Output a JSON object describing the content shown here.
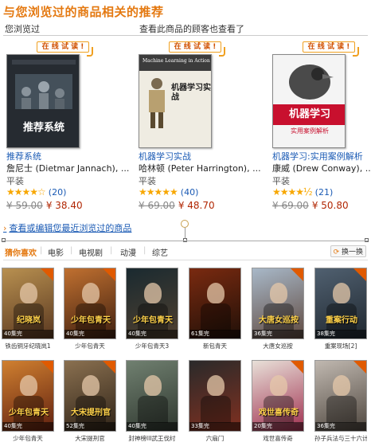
{
  "header": {
    "title": "与您浏览过的商品相关的推荐",
    "viewed_label": "您浏览过",
    "also_viewed_label": "查看此商品的顾客也查看了"
  },
  "badge_text": "在 线 试 读 !",
  "books": [
    {
      "title": "推荐系统",
      "author": "詹尼士 (Dietmar Jannach), ...",
      "format": "平装",
      "rating": 4,
      "stars_text": "★★★★☆",
      "review_count": "(20)",
      "list_price": "¥ 59.00",
      "price": "¥ 38.40",
      "cover_title": "推荐系统",
      "cover_color": "#2a2f36"
    },
    {
      "title": "机器学习实战",
      "author": "哈林顿 (Peter Harrington), ...",
      "format": "平装",
      "rating": 5,
      "stars_text": "★★★★★",
      "review_count": "(40)",
      "list_price": "¥ 69.00",
      "price": "¥ 48.70",
      "cover_title": "机器学习实战",
      "cover_subtitle": "Machine Learning in Action",
      "cover_color": "#efece2"
    },
    {
      "title": "机器学习:实用案例解析",
      "author": "康威 (Drew Conway), ...",
      "format": "平装",
      "rating": 4.5,
      "stars_text": "★★★★½",
      "review_count": "(21)",
      "list_price": "¥ 69.00",
      "price": "¥ 50.80",
      "cover_title": "机器学习",
      "cover_subtitle": "实用案例解析",
      "cover_color": "#f4f4f4",
      "cover_band": "#c8102e"
    }
  ],
  "edit_link": "查看或编辑您最近浏览过的商品",
  "tabs": [
    "猜你喜欢",
    "电影",
    "电视剧",
    "动漫",
    "综艺"
  ],
  "switch_label": "换一换",
  "movies": [
    {
      "title": "铁齿铜牙纪晓岚1",
      "episodes": "40集完",
      "poster_text": "纪晓岚",
      "c1": "#b89050",
      "c2": "#5a3820"
    },
    {
      "title": "少年包青天",
      "episodes": "40集完",
      "poster_text": "少年包青天",
      "c1": "#c07030",
      "c2": "#402010"
    },
    {
      "title": "少年包青天3",
      "episodes": "40集完",
      "poster_text": "少年包青天",
      "c1": "#1a2a30",
      "c2": "#504030"
    },
    {
      "title": "新包青天",
      "episodes": "61集完",
      "poster_text": "",
      "c1": "#7a2a10",
      "c2": "#201008"
    },
    {
      "title": "大唐女巡按",
      "episodes": "36集完",
      "poster_text": "大唐女巡按",
      "c1": "#a8b8c8",
      "c2": "#604a40"
    },
    {
      "title": "重案现场[2]",
      "episodes": "38集完",
      "poster_text": "重案行动",
      "c1": "#506070",
      "c2": "#202830"
    },
    {
      "title": "少年包青天",
      "episodes": "40集完",
      "poster_text": "少年包青天",
      "c1": "#d08030",
      "c2": "#602010"
    },
    {
      "title": "大宋提刑官",
      "episodes": "52集完",
      "poster_text": "大宋提刑官",
      "c1": "#8a7050",
      "c2": "#302418"
    },
    {
      "title": "封神榜III武王伐纣",
      "episodes": "40集完",
      "poster_text": "",
      "c1": "#708070",
      "c2": "#303830"
    },
    {
      "title": "六扇门",
      "episodes": "33集完",
      "poster_text": "",
      "c1": "#2a2a2a",
      "c2": "#803020"
    },
    {
      "title": "戏世喜传奇",
      "episodes": "20集完",
      "poster_text": "戏世喜传奇",
      "c1": "#e8e0d8",
      "c2": "#a03050"
    },
    {
      "title": "孙子兵法与三十六计",
      "episodes": "36集完",
      "poster_text": "",
      "c1": "#c0b8b0",
      "c2": "#504840"
    }
  ]
}
